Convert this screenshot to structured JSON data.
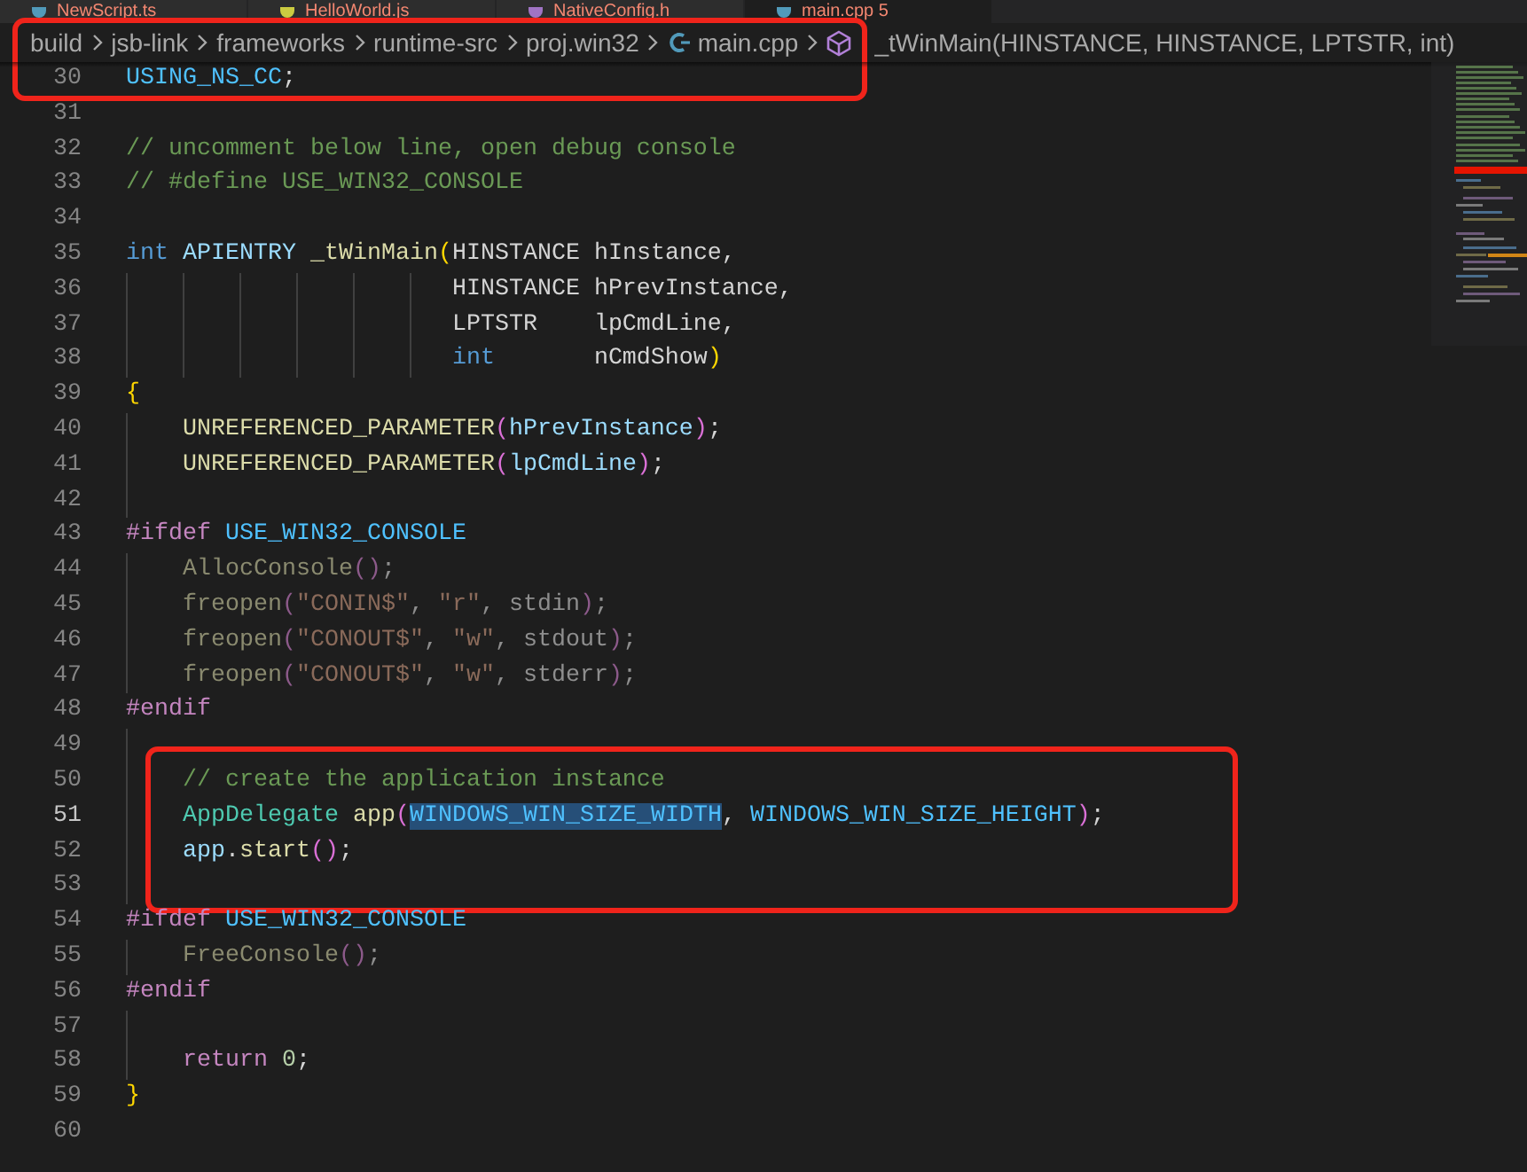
{
  "tabs": [
    {
      "label": "NewScript.ts",
      "selected": false
    },
    {
      "label": "HelloWorld.js",
      "selected": false
    },
    {
      "label": "NativeConfig.h",
      "selected": false
    },
    {
      "label": "main.cpp 5",
      "selected": true
    }
  ],
  "breadcrumb": {
    "framed": true,
    "segments": [
      {
        "kind": "folder",
        "text": "build"
      },
      {
        "kind": "folder",
        "text": "jsb-link"
      },
      {
        "kind": "folder",
        "text": "frameworks"
      },
      {
        "kind": "folder",
        "text": "runtime-src"
      },
      {
        "kind": "folder",
        "text": "proj.win32"
      },
      {
        "kind": "file",
        "text": "main.cpp"
      },
      {
        "kind": "symbol",
        "text": "_tWinMain(HINSTANCE, HINSTANCE, LPTSTR, int)"
      }
    ]
  },
  "editor": {
    "blocks": [
      {
        "framed": true,
        "lines": [
          {
            "number": "30",
            "current": false,
            "tokens": [
              {
                "kind": "macro",
                "text": "USING_NS_CC"
              },
              {
                "kind": "plain",
                "text": ";"
              }
            ]
          }
        ]
      },
      {
        "framed": false,
        "lines": [
          {
            "number": "31",
            "current": false
          },
          {
            "number": "32",
            "current": false,
            "tokens": [
              {
                "kind": "comment",
                "text": "// uncomment below line, open debug console"
              }
            ]
          },
          {
            "number": "33",
            "current": false,
            "tokens": [
              {
                "kind": "comment",
                "text": "// #define USE_WIN32_CONSOLE"
              }
            ]
          },
          {
            "number": "34",
            "current": false
          },
          {
            "number": "35",
            "current": false,
            "tokens": [
              {
                "kind": "keyword",
                "text": "int "
              },
              {
                "kind": "variable",
                "text": "APIENTRY "
              },
              {
                "kind": "function",
                "text": "_tWinMain"
              },
              {
                "kind": "paren1",
                "text": "("
              },
              {
                "kind": "plain",
                "text": "HINSTANCE hInstance,"
              }
            ]
          },
          {
            "number": "36",
            "current": false,
            "tokens": [
              {
                "kind": "plain",
                "text": "                       HINSTANCE hPrevInstance,"
              }
            ]
          },
          {
            "number": "37",
            "current": false,
            "tokens": [
              {
                "kind": "plain",
                "text": "                       LPTSTR    lpCmdLine,"
              }
            ]
          },
          {
            "number": "38",
            "current": false,
            "tokens": [
              {
                "kind": "keyword",
                "text": "                       int"
              },
              {
                "kind": "plain",
                "text": "       nCmdShow"
              },
              {
                "kind": "paren1",
                "text": ")"
              }
            ]
          },
          {
            "number": "39",
            "current": false,
            "tokens": [
              {
                "kind": "paren1",
                "text": "{"
              }
            ]
          },
          {
            "number": "40",
            "current": false,
            "tokens": [
              {
                "kind": "function",
                "text": "    UNREFERENCED_PARAMETER"
              },
              {
                "kind": "paren2",
                "text": "("
              },
              {
                "kind": "variable",
                "text": "hPrevInstance"
              },
              {
                "kind": "paren2",
                "text": ")"
              },
              {
                "kind": "plain",
                "text": ";"
              }
            ]
          },
          {
            "number": "41",
            "current": false,
            "tokens": [
              {
                "kind": "function",
                "text": "    UNREFERENCED_PARAMETER"
              },
              {
                "kind": "paren2",
                "text": "("
              },
              {
                "kind": "variable",
                "text": "lpCmdLine"
              },
              {
                "kind": "paren2",
                "text": ")"
              },
              {
                "kind": "plain",
                "text": ";"
              }
            ]
          },
          {
            "number": "42",
            "current": false
          },
          {
            "number": "43",
            "current": false,
            "tokens": [
              {
                "kind": "preproc",
                "text": "#ifdef "
              },
              {
                "kind": "macro",
                "text": "USE_WIN32_CONSOLE"
              }
            ]
          },
          {
            "number": "44",
            "current": false,
            "tokens": [
              {
                "kind": "inactive_function",
                "text": "    AllocConsole"
              },
              {
                "kind": "inactive_paren",
                "text": "()"
              },
              {
                "kind": "inactive_plain",
                "text": ";"
              }
            ]
          },
          {
            "number": "45",
            "current": false,
            "tokens": [
              {
                "kind": "inactive_function",
                "text": "    freopen"
              },
              {
                "kind": "inactive_paren",
                "text": "("
              },
              {
                "kind": "inactive_string",
                "text": "\"CONIN$\""
              },
              {
                "kind": "inactive_plain",
                "text": ", "
              },
              {
                "kind": "inactive_string",
                "text": "\"r\""
              },
              {
                "kind": "inactive_plain",
                "text": ", stdin"
              },
              {
                "kind": "inactive_paren",
                "text": ")"
              },
              {
                "kind": "inactive_plain",
                "text": ";"
              }
            ]
          },
          {
            "number": "46",
            "current": false,
            "tokens": [
              {
                "kind": "inactive_function",
                "text": "    freopen"
              },
              {
                "kind": "inactive_paren",
                "text": "("
              },
              {
                "kind": "inactive_string",
                "text": "\"CONOUT$\""
              },
              {
                "kind": "inactive_plain",
                "text": ", "
              },
              {
                "kind": "inactive_string",
                "text": "\"w\""
              },
              {
                "kind": "inactive_plain",
                "text": ", stdout"
              },
              {
                "kind": "inactive_paren",
                "text": ")"
              },
              {
                "kind": "inactive_plain",
                "text": ";"
              }
            ]
          },
          {
            "number": "47",
            "current": false,
            "tokens": [
              {
                "kind": "inactive_function",
                "text": "    freopen"
              },
              {
                "kind": "inactive_paren",
                "text": "("
              },
              {
                "kind": "inactive_string",
                "text": "\"CONOUT$\""
              },
              {
                "kind": "inactive_plain",
                "text": ", "
              },
              {
                "kind": "inactive_string",
                "text": "\"w\""
              },
              {
                "kind": "inactive_plain",
                "text": ", stderr"
              },
              {
                "kind": "inactive_paren",
                "text": ")"
              },
              {
                "kind": "inactive_plain",
                "text": ";"
              }
            ]
          },
          {
            "number": "48",
            "current": false,
            "tokens": [
              {
                "kind": "preproc",
                "text": "#endif"
              }
            ]
          },
          {
            "number": "49",
            "current": false
          }
        ]
      },
      {
        "framed": true,
        "lines": [
          {
            "number": "50",
            "current": false,
            "tokens": [
              {
                "kind": "comment",
                "text": "    // create the application instance"
              }
            ]
          },
          {
            "number": "51",
            "current": true,
            "tokens": [
              {
                "kind": "type",
                "text": "    AppDelegate "
              },
              {
                "kind": "function",
                "text": "app"
              },
              {
                "kind": "paren2",
                "text": "("
              },
              {
                "kind": "macro",
                "text": "WINDOWS_WIN_SIZE_WIDTH",
                "selected": true
              },
              {
                "kind": "plain",
                "text": ", "
              },
              {
                "kind": "macro",
                "text": "WINDOWS_WIN_SIZE_HEIGHT"
              },
              {
                "kind": "paren2",
                "text": ")"
              },
              {
                "kind": "plain",
                "text": ";"
              }
            ]
          },
          {
            "number": "52",
            "current": false,
            "tokens": [
              {
                "kind": "variable",
                "text": "    app"
              },
              {
                "kind": "plain",
                "text": "."
              },
              {
                "kind": "function",
                "text": "start"
              },
              {
                "kind": "paren2",
                "text": "()"
              },
              {
                "kind": "plain",
                "text": ";"
              }
            ]
          },
          {
            "number": "53",
            "current": false
          }
        ]
      },
      {
        "framed": false,
        "lines": [
          {
            "number": "54",
            "current": false,
            "tokens": [
              {
                "kind": "preproc",
                "text": "#ifdef "
              },
              {
                "kind": "macro",
                "text": "USE_WIN32_CONSOLE"
              }
            ]
          },
          {
            "number": "55",
            "current": false,
            "tokens": [
              {
                "kind": "inactive_function",
                "text": "    FreeConsole"
              },
              {
                "kind": "inactive_paren",
                "text": "()"
              },
              {
                "kind": "inactive_plain",
                "text": ";"
              }
            ]
          },
          {
            "number": "56",
            "current": false,
            "tokens": [
              {
                "kind": "preproc",
                "text": "#endif"
              }
            ]
          },
          {
            "number": "57",
            "current": false
          },
          {
            "number": "58",
            "current": false,
            "tokens": [
              {
                "kind": "keyword2",
                "text": "    return "
              },
              {
                "kind": "number",
                "text": "0"
              },
              {
                "kind": "plain",
                "text": ";"
              }
            ]
          },
          {
            "number": "59",
            "current": false,
            "tokens": [
              {
                "kind": "paren1",
                "text": "}"
              }
            ]
          },
          {
            "number": "60",
            "current": false
          }
        ]
      }
    ]
  }
}
